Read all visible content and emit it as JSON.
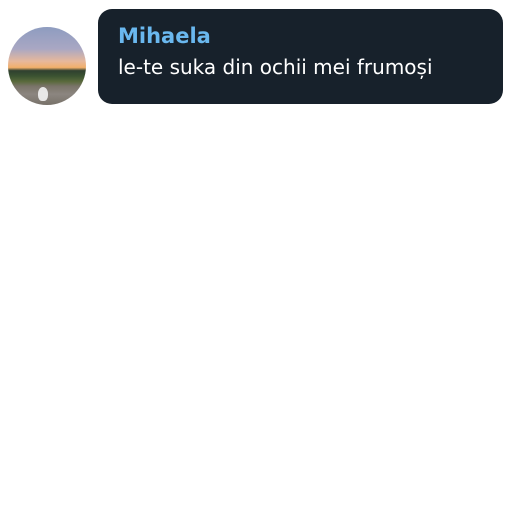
{
  "message": {
    "sender": "Mihaela",
    "text": "le-te suka din ochii mei frumoși",
    "sender_color": "#6ab8ef",
    "bubble_color": "#17212b",
    "text_color": "#ffffff"
  },
  "avatar": {
    "icon": "avatar-photo"
  }
}
